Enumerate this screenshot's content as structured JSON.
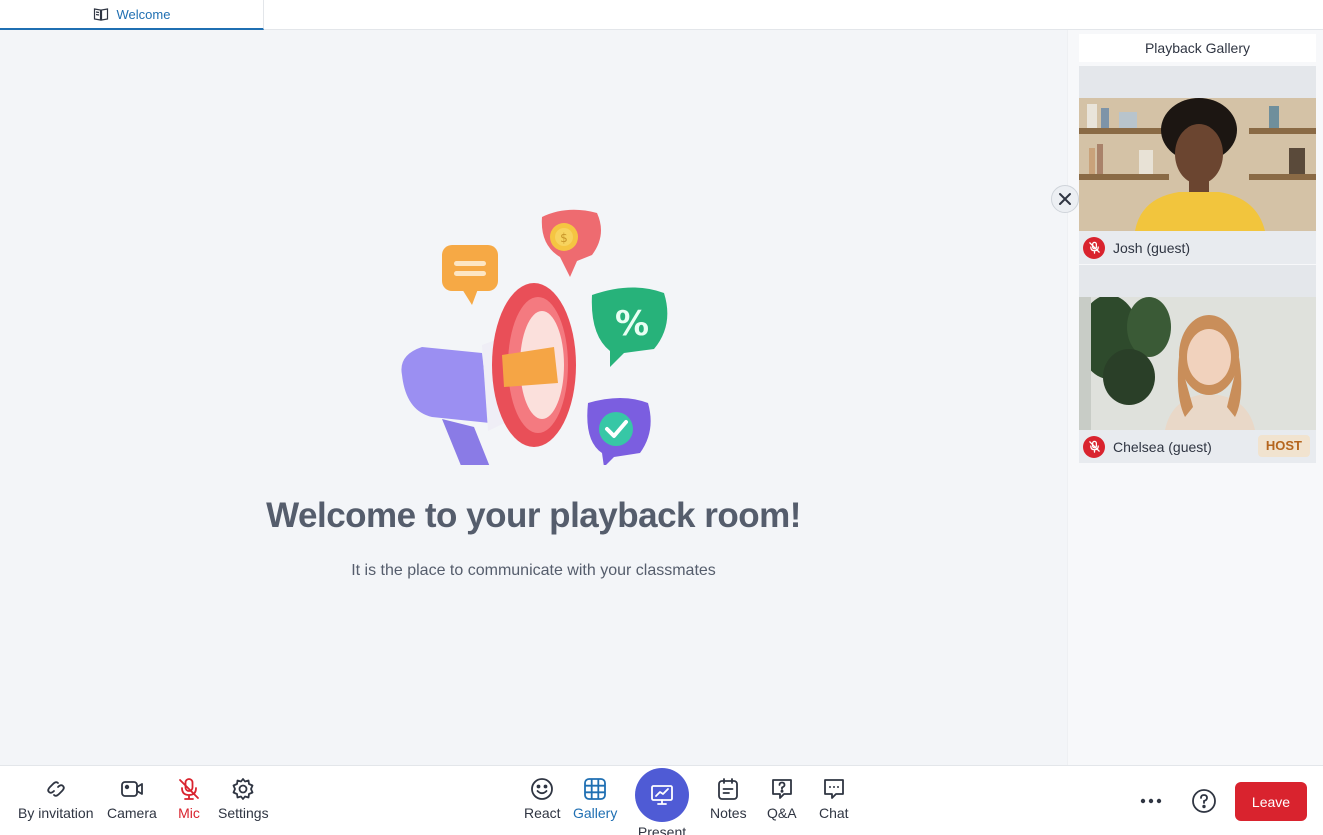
{
  "tabs": [
    {
      "label": "Welcome",
      "icon": "book-icon",
      "active": true
    }
  ],
  "stage": {
    "title": "Welcome to your playback room!",
    "subtitle": "It is the place to communicate with your classmates"
  },
  "gallery": {
    "title": "Playback Gallery",
    "participants": [
      {
        "name": "Josh (guest)",
        "muted": true,
        "badge": ""
      },
      {
        "name": "Chelsea (guest)",
        "muted": true,
        "badge": "HOST"
      }
    ]
  },
  "toolbar": {
    "left": [
      {
        "label": "By invitation",
        "icon": "link-icon"
      },
      {
        "label": "Camera",
        "icon": "camera-icon"
      },
      {
        "label": "Mic",
        "icon": "mic-off-icon",
        "color": "#d9232e"
      },
      {
        "label": "Settings",
        "icon": "gear-icon"
      }
    ],
    "center": [
      {
        "label": "React",
        "icon": "smile-icon"
      },
      {
        "label": "Gallery",
        "icon": "grid-icon",
        "color": "#1f6fb2"
      },
      {
        "label": "Present",
        "icon": "presentation-icon"
      },
      {
        "label": "Notes",
        "icon": "notes-icon"
      },
      {
        "label": "Q&A",
        "icon": "question-bubble-icon"
      },
      {
        "label": "Chat",
        "icon": "chat-icon"
      }
    ],
    "leave_label": "Leave"
  },
  "colors": {
    "accent": "#1f6fb2",
    "present": "#4f5bd5",
    "danger": "#d9232e",
    "host_badge_bg": "#f1e3cf",
    "host_badge_fg": "#b5651d"
  }
}
